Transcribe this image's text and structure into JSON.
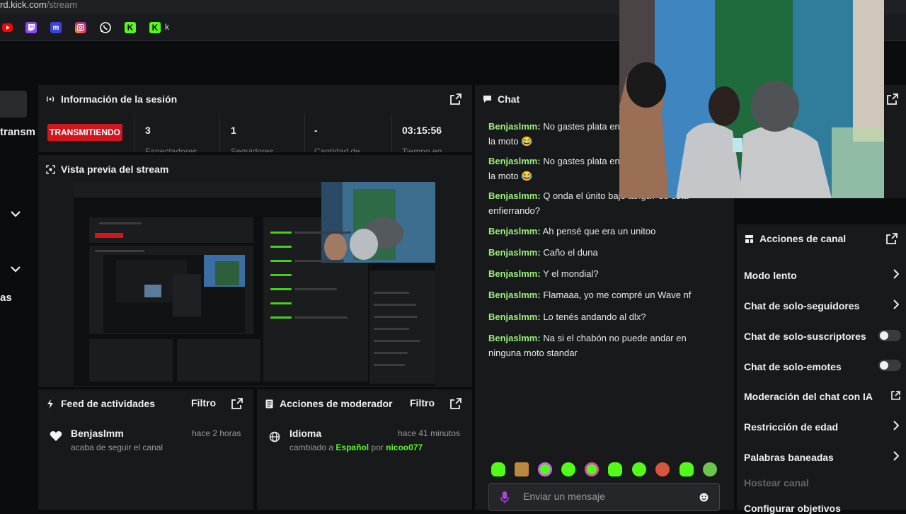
{
  "browser": {
    "url_prefix": "rd.kick.com",
    "url_path": "/stream",
    "bookmarks": [
      {
        "icon": "youtube-icon",
        "color": "#ff0000"
      },
      {
        "icon": "twitch-icon",
        "color": "#9146ff"
      },
      {
        "icon": "m-icon",
        "color": "#3b44d8",
        "letter": "m"
      },
      {
        "icon": "instagram-icon",
        "color": "#e1306c"
      },
      {
        "icon": "whatsapp-icon",
        "color": "#25d366"
      },
      {
        "icon": "kick-icon",
        "color": "#53fc18",
        "letter": "K"
      },
      {
        "icon": "kick-icon",
        "color": "#53fc18",
        "letter": "K"
      }
    ],
    "bookmark_last_label": "k"
  },
  "sidebar": {
    "partial_label_1": "transm",
    "partial_label_2": "as"
  },
  "session": {
    "title": "Información de la sesión",
    "status": "TRANSMITIENDO",
    "stats": [
      {
        "value": "3",
        "label": "Espectadores"
      },
      {
        "value": "1",
        "label": "Seguidores"
      },
      {
        "value": "-",
        "label": "Cantidad de"
      },
      {
        "value": "03:15:56",
        "label": "Tiempo en"
      }
    ]
  },
  "preview": {
    "title": "Vista previa del stream"
  },
  "feed": {
    "title": "Feed de actividades",
    "filter": "Filtro",
    "items": [
      {
        "user": "Benjaslmm",
        "action": "acaba de seguir el canal",
        "time": "hace 2 horas"
      }
    ]
  },
  "mod_actions": {
    "title": "Acciones de moderador",
    "filter": "Filtro",
    "items": [
      {
        "type": "Idioma",
        "prefix": "cambiado a",
        "value": "Español",
        "by": "por",
        "user": "nicoo077",
        "time": "hace 41 minutos"
      }
    ]
  },
  "chat": {
    "title": "Chat",
    "messages": [
      {
        "user": "Benjaslmm:",
        "text": "No gastes plata en comprale cosas a la moto 😂"
      },
      {
        "user": "Benjaslmm:",
        "text": "No gastes plata en comprale cosas a la moto 😂"
      },
      {
        "user": "Benjaslmm:",
        "text": "Q onda el únito bajo tanga? se está enfierrando?"
      },
      {
        "user": "Benjaslmm:",
        "text": "Ah pensé que era un unitoo"
      },
      {
        "user": "Benjaslmm:",
        "text": "Caño el duna"
      },
      {
        "user": "Benjaslmm:",
        "text": "Y el mondial?"
      },
      {
        "user": "Benjaslmm:",
        "text": "Flamaaa, yo me compré un Wave nf"
      },
      {
        "user": "Benjaslmm:",
        "text": "Lo tenés andando al dlx?"
      },
      {
        "user": "Benjaslmm:",
        "text": "Na si el chabón no puede andar en ninguna moto standar"
      }
    ],
    "input_placeholder": "Enviar un mensaje"
  },
  "channel_actions": {
    "title": "Acciones de canal",
    "rows": [
      {
        "label": "Modo lento",
        "control": "chevron"
      },
      {
        "label": "Chat de solo-seguidores",
        "control": "chevron"
      },
      {
        "label": "Chat de solo-suscriptores",
        "control": "toggle",
        "on": false
      },
      {
        "label": "Chat de solo-emotes",
        "control": "toggle",
        "on": false
      },
      {
        "label": "Moderación del chat con IA",
        "control": "external"
      },
      {
        "label": "Restricción de edad",
        "control": "chevron"
      },
      {
        "label": "Palabras baneadas",
        "control": "chevron"
      },
      {
        "label": "Hostear canal",
        "control": "none",
        "disabled": true
      },
      {
        "label": "Configurar objetivos",
        "control": "none"
      }
    ]
  },
  "colors": {
    "kick_green": "#53fc18",
    "live_red": "#d2161e",
    "chat_user": "#9bef7a"
  }
}
